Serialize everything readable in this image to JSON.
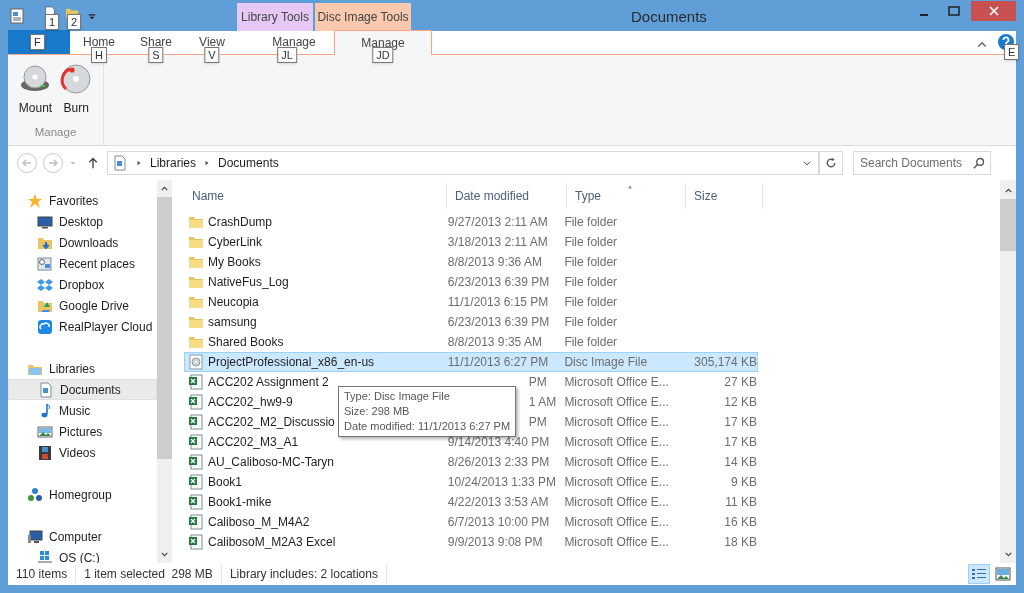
{
  "window": {
    "title": "Documents"
  },
  "quick_access": {
    "keytips": [
      "1",
      "2"
    ]
  },
  "contextual_groups": [
    {
      "label": "Library Tools",
      "color": "#e6c8f5"
    },
    {
      "label": "Disc Image Tools",
      "color": "#f9c9ad"
    }
  ],
  "file_tab": {
    "keytip": "F"
  },
  "tabs": [
    {
      "label": "Home",
      "keytip": "H",
      "selected": false
    },
    {
      "label": "Share",
      "keytip": "S",
      "selected": false
    },
    {
      "label": "View",
      "keytip": "V",
      "selected": false
    },
    {
      "label": "Manage",
      "keytip": "JL",
      "selected": false
    },
    {
      "label": "Manage",
      "keytip": "JD",
      "selected": true
    }
  ],
  "help_keytip": "E",
  "ribbon": {
    "buttons": [
      {
        "label": "Mount",
        "kind": "mount"
      },
      {
        "label": "Burn",
        "kind": "burn"
      }
    ],
    "group_label": "Manage"
  },
  "address": {
    "path": [
      "Libraries",
      "Documents"
    ],
    "search_placeholder": "Search Documents"
  },
  "nav": [
    {
      "label": "Favorites",
      "kind": "star",
      "selected": false,
      "children": [
        {
          "label": "Desktop",
          "kind": "desktop",
          "selected": false
        },
        {
          "label": "Downloads",
          "kind": "downloads",
          "selected": false
        },
        {
          "label": "Recent places",
          "kind": "recent",
          "selected": false
        },
        {
          "label": "Dropbox",
          "kind": "dropbox",
          "selected": false
        },
        {
          "label": "Google Drive",
          "kind": "gdrive",
          "selected": false
        },
        {
          "label": "RealPlayer Cloud",
          "kind": "cloud",
          "selected": false
        }
      ]
    },
    {
      "label": "Libraries",
      "kind": "library",
      "selected": false,
      "children": [
        {
          "label": "Documents",
          "kind": "document",
          "selected": true
        },
        {
          "label": "Music",
          "kind": "music",
          "selected": false
        },
        {
          "label": "Pictures",
          "kind": "pictures",
          "selected": false
        },
        {
          "label": "Videos",
          "kind": "videos",
          "selected": false
        }
      ]
    },
    {
      "label": "Homegroup",
      "kind": "homegroup",
      "selected": false
    },
    {
      "label": "Computer",
      "kind": "computer",
      "selected": false,
      "children": [
        {
          "label": "OS (C:)",
          "kind": "drive",
          "selected": false
        }
      ]
    }
  ],
  "table": {
    "columns": [
      {
        "label": "Name",
        "sorted": false
      },
      {
        "label": "Date modified",
        "sorted": false
      },
      {
        "label": "Type",
        "sorted": true
      },
      {
        "label": "Size",
        "sorted": false
      }
    ],
    "rows": [
      {
        "name": "CrashDump",
        "date": "9/27/2013 2:11 AM",
        "type": "File folder",
        "size": "",
        "kind": "folder",
        "selected": false,
        "date_covered": false
      },
      {
        "name": "CyberLink",
        "date": "3/18/2013 2:11 AM",
        "type": "File folder",
        "size": "",
        "kind": "folder",
        "selected": false,
        "date_covered": false
      },
      {
        "name": "My Books",
        "date": "8/8/2013 9:36 AM",
        "type": "File folder",
        "size": "",
        "kind": "folder",
        "selected": false,
        "date_covered": false
      },
      {
        "name": "NativeFus_Log",
        "date": "6/23/2013 6:39 PM",
        "type": "File folder",
        "size": "",
        "kind": "folder",
        "selected": false,
        "date_covered": false
      },
      {
        "name": "Neucopia",
        "date": "11/1/2013 6:15 PM",
        "type": "File folder",
        "size": "",
        "kind": "folder",
        "selected": false,
        "date_covered": false
      },
      {
        "name": "samsung",
        "date": "6/23/2013 6:39 PM",
        "type": "File folder",
        "size": "",
        "kind": "folder",
        "selected": false,
        "date_covered": false
      },
      {
        "name": "Shared Books",
        "date": "8/8/2013 9:35 AM",
        "type": "File folder",
        "size": "",
        "kind": "folder",
        "selected": false,
        "date_covered": false
      },
      {
        "name": "ProjectProfessional_x86_en-us",
        "date": "11/1/2013 6:27 PM",
        "type": "Disc Image File",
        "size": "305,174 KB",
        "kind": "disc",
        "selected": true,
        "date_covered": false
      },
      {
        "name": "ACC202 Assignment 2",
        "date": "PM",
        "type": "Microsoft Office E...",
        "size": "27 KB",
        "kind": "excel",
        "selected": false,
        "date_covered": true
      },
      {
        "name": "ACC202_hw9-9",
        "date": "1 AM",
        "type": "Microsoft Office E...",
        "size": "12 KB",
        "kind": "excel",
        "selected": false,
        "date_covered": true
      },
      {
        "name": "ACC202_M2_Discussio",
        "date": "PM",
        "type": "Microsoft Office E...",
        "size": "17 KB",
        "kind": "excel",
        "selected": false,
        "date_covered": true
      },
      {
        "name": "ACC202_M3_A1",
        "date": "9/14/2013 4:40 PM",
        "type": "Microsoft Office E...",
        "size": "17 KB",
        "kind": "excel",
        "selected": false,
        "date_covered": false
      },
      {
        "name": "AU_Caliboso-MC-Taryn",
        "date": "8/26/2013 2:33 PM",
        "type": "Microsoft Office E...",
        "size": "14 KB",
        "kind": "excel",
        "selected": false,
        "date_covered": false
      },
      {
        "name": "Book1",
        "date": "10/24/2013 1:33 PM",
        "type": "Microsoft Office E...",
        "size": "9 KB",
        "kind": "excel",
        "selected": false,
        "date_covered": false
      },
      {
        "name": "Book1-mike",
        "date": "4/22/2013 3:53 AM",
        "type": "Microsoft Office E...",
        "size": "11 KB",
        "kind": "excel",
        "selected": false,
        "date_covered": false
      },
      {
        "name": "Caliboso_M_M4A2",
        "date": "6/7/2013 10:00 PM",
        "type": "Microsoft Office E...",
        "size": "16 KB",
        "kind": "excel",
        "selected": false,
        "date_covered": false
      },
      {
        "name": "CalibosoM_M2A3 Excel",
        "date": "9/9/2013 9:08 PM",
        "type": "Microsoft Office E...",
        "size": "18 KB",
        "kind": "excel",
        "selected": false,
        "date_covered": false
      }
    ]
  },
  "tooltip": [
    "Type: Disc Image File",
    "Size: 298 MB",
    "Date modified: 11/1/2013 6:27 PM"
  ],
  "status_bar": [
    "110 items",
    "1 item selected  298 MB",
    "Library includes: 2 locations"
  ],
  "views": [
    {
      "kind": "details",
      "selected": true
    },
    {
      "kind": "thumbnails",
      "selected": false
    }
  ]
}
